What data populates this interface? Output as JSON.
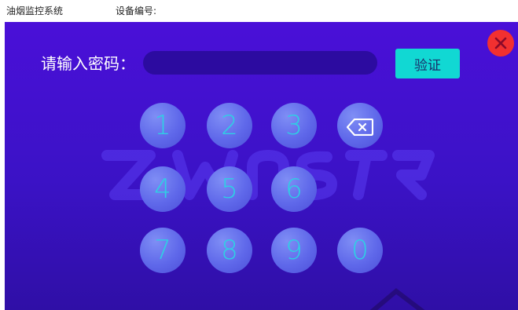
{
  "topbar": {
    "app_title": "油烟监控系统",
    "device_label": "设备编号:"
  },
  "auth": {
    "label": "请输入密码：",
    "input_value": "",
    "verify_label": "验证"
  },
  "keypad": {
    "keys": [
      "1",
      "2",
      "3",
      "4",
      "5",
      "6",
      "7",
      "8",
      "9",
      "0"
    ],
    "backspace_icon": "backspace-icon"
  },
  "icons": {
    "close": "close-icon"
  },
  "colors": {
    "panel_bg": "#4010d0",
    "key_bg": "#5f68ea",
    "key_text": "#2ed0e4",
    "verify_bg": "#11d8d3",
    "close_bg": "#f23030"
  }
}
